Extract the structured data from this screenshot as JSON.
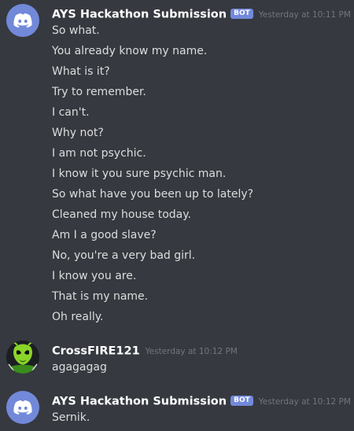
{
  "groups": [
    {
      "username": "AYS Hackathon Submission",
      "bot_tag": "BOT",
      "timestamp": "Yesterday at 10:11 PM",
      "lines": [
        "So what.",
        "You already know my name.",
        "What is it?",
        "Try to remember.",
        "I can't.",
        "Why not?",
        "I am not psychic.",
        "I know it you sure psychic man.",
        "So what have you been up to lately?",
        "Cleaned my house today.",
        "Am I a good slave?",
        "No, you're a very bad girl.",
        "I know you are.",
        "That is my name.",
        "Oh really."
      ]
    },
    {
      "username": "CrossFIRE121",
      "timestamp": "Yesterday at 10:12 PM",
      "lines": [
        "agagagag"
      ]
    },
    {
      "username": "AYS Hackathon Submission",
      "bot_tag": "BOT",
      "timestamp": "Yesterday at 10:12 PM",
      "lines": [
        "Sernik."
      ]
    }
  ],
  "colors": {
    "background": "#36393f",
    "blurple": "#7289da",
    "username": "#ffffff",
    "message_text": "#dcddde",
    "timestamp": "#72767d"
  },
  "icons": {
    "bot_avatar": "discord-logo-icon",
    "user_avatar": "green-alien-character-icon"
  }
}
